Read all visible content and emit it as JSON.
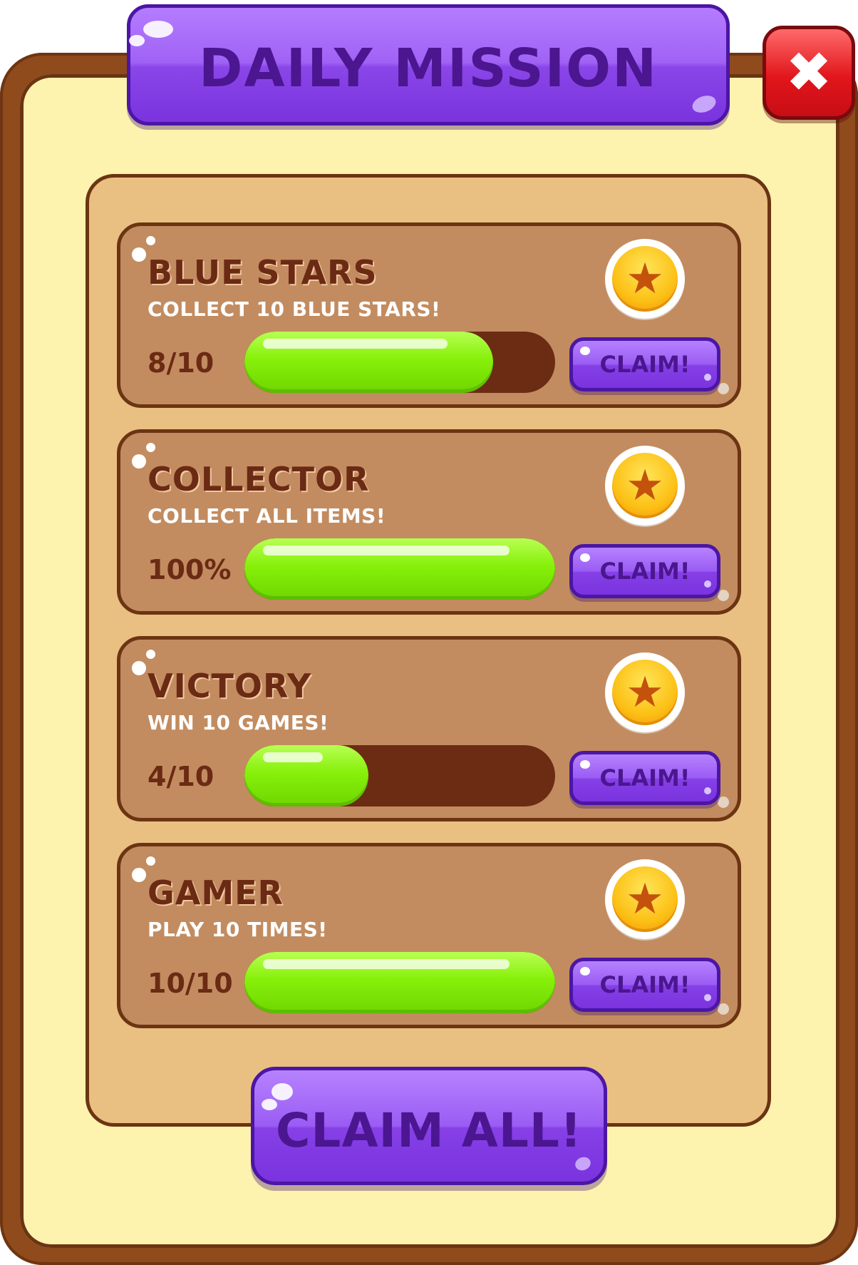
{
  "header": {
    "title": "DAILY MISSION"
  },
  "close": {
    "symbol": "✖"
  },
  "missions": [
    {
      "title": "BLUE STARS",
      "description": "COLLECT 10 BLUE STARS!",
      "progress_text": "8/10",
      "progress_fraction": 0.8,
      "claim_label": "CLAIM!"
    },
    {
      "title": "COLLECTOR",
      "description": "COLLECT ALL ITEMS!",
      "progress_text": "100%",
      "progress_fraction": 1.0,
      "claim_label": "CLAIM!"
    },
    {
      "title": "VICTORY",
      "description": "WIN 10 GAMES!",
      "progress_text": "4/10",
      "progress_fraction": 0.4,
      "claim_label": "CLAIM!"
    },
    {
      "title": "GAMER",
      "description": "PLAY 10 TIMES!",
      "progress_text": "10/10",
      "progress_fraction": 1.0,
      "claim_label": "CLAIM!"
    }
  ],
  "footer": {
    "claim_all_label": "CLAIM ALL!"
  },
  "icons": {
    "reward": "star-coin-icon",
    "close": "close-icon"
  },
  "colors": {
    "accent": "#8a46e8",
    "progress": "#86f00a",
    "close": "#e1161c",
    "panel": "#c28c60"
  }
}
